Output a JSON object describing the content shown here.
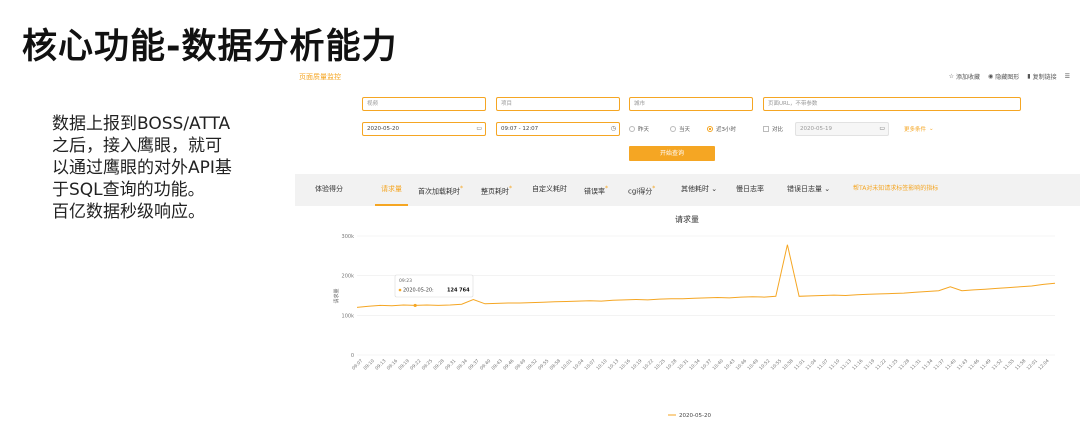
{
  "slide": {
    "title": "核心功能-数据分析能力",
    "desc_lines": [
      "数据上报到BOSS/ATTA",
      "之后，接入鹰眼，就可",
      "以通过鹰眼的对外API基",
      "于SQL查询的功能。",
      "百亿数据秒级响应。"
    ]
  },
  "app": {
    "title": "页面质量监控",
    "actions": {
      "favorite": "添加收藏",
      "hide_chart": "隐藏图形",
      "copy_link": "复制链接"
    },
    "filters": {
      "field1": "视频",
      "field2": "项目",
      "field3": "城市",
      "field4_placeholder": "页面URL，不带参数",
      "date": "2020-05-20",
      "time_range": "09:07 - 12:07",
      "radio_yesterday": "昨天",
      "radio_today": "当天",
      "radio_recent3h": "近3小时",
      "compare_label": "对比",
      "compare_date": "2020-05-19",
      "more_conditions": "更多条件",
      "query_button": "开始查询"
    },
    "tabs": [
      {
        "label": "体验得分"
      },
      {
        "label": "请求量"
      },
      {
        "label": "首次加载耗时"
      },
      {
        "label": "整页耗时"
      },
      {
        "label": "自定义耗时"
      },
      {
        "label": "错误率"
      },
      {
        "label": "cgi得分"
      },
      {
        "label": "其他耗时"
      },
      {
        "label": "慢日志率"
      },
      {
        "label": "错误日志量"
      },
      {
        "label": "帮TA对未知请求标签影响的指标"
      }
    ],
    "active_tab": "请求量"
  },
  "colors": {
    "accent": "#f5a623",
    "tab_bar": "#f2f2f2",
    "text": "#222222"
  },
  "chart_data": {
    "type": "line",
    "title": "请求量",
    "ylabel": "请求量",
    "ylim": [
      0,
      300000
    ],
    "yticks": [
      "0",
      "100k",
      "200k",
      "300k"
    ],
    "x_tick_labels": [
      "09:07",
      "09:10",
      "09:13",
      "09:16",
      "09:19",
      "09:22",
      "09:25",
      "09:28",
      "09:31",
      "09:34",
      "09:37",
      "09:40",
      "09:43",
      "09:46",
      "09:49",
      "09:52",
      "09:55",
      "09:58",
      "10:01",
      "10:04",
      "10:07",
      "10:10",
      "10:13",
      "10:16",
      "10:19",
      "10:22",
      "10:25",
      "10:28",
      "10:31",
      "10:34",
      "10:37",
      "10:40",
      "10:43",
      "10:46",
      "10:49",
      "10:52",
      "10:55",
      "10:58",
      "11:01",
      "11:04",
      "11:07",
      "11:10",
      "11:13",
      "11:16",
      "11:19",
      "11:22",
      "11:25",
      "11:28",
      "11:31",
      "11:34",
      "11:37",
      "11:40",
      "11:43",
      "11:46",
      "11:49",
      "11:52",
      "11:55",
      "11:58",
      "12:01",
      "12:04"
    ],
    "series": [
      {
        "name": "2020-05-20",
        "color": "#f5a623",
        "x": [
          "09:07",
          "09:10",
          "09:13",
          "09:16",
          "09:19",
          "09:22",
          "09:25",
          "09:28",
          "09:31",
          "09:34",
          "09:37",
          "09:40",
          "09:43",
          "09:46",
          "09:49",
          "09:52",
          "09:55",
          "09:58",
          "10:01",
          "10:04",
          "10:07",
          "10:10",
          "10:13",
          "10:16",
          "10:19",
          "10:22",
          "10:25",
          "10:28",
          "10:31",
          "10:34",
          "10:37",
          "10:40",
          "10:43",
          "10:46",
          "10:49",
          "10:52",
          "10:55",
          "10:58",
          "11:01",
          "11:04",
          "11:07",
          "11:10",
          "11:13",
          "11:16",
          "11:19",
          "11:22",
          "11:25",
          "11:28",
          "11:31",
          "11:34",
          "11:37",
          "11:40",
          "11:43",
          "11:46",
          "11:49",
          "11:52",
          "11:55",
          "11:58",
          "12:01",
          "12:04",
          "12:07"
        ],
        "values": [
          120000,
          123000,
          125000,
          124000,
          126000,
          125000,
          126000,
          125000,
          126000,
          128000,
          140000,
          129000,
          130000,
          131000,
          131000,
          132000,
          133000,
          134000,
          135000,
          136000,
          137000,
          136000,
          138000,
          139000,
          140000,
          139000,
          141000,
          142000,
          142000,
          143000,
          144000,
          145000,
          144000,
          146000,
          147000,
          146000,
          148000,
          278000,
          148000,
          149000,
          150000,
          151000,
          150000,
          152000,
          153000,
          154000,
          155000,
          156000,
          158000,
          160000,
          162000,
          172000,
          162000,
          164000,
          166000,
          168000,
          170000,
          172000,
          174000,
          178000,
          181000
        ]
      }
    ],
    "tooltip": {
      "time": "09:23",
      "date_label": "2020-05-20:",
      "value": "124 764"
    },
    "legend": "bottom",
    "grid": true
  }
}
